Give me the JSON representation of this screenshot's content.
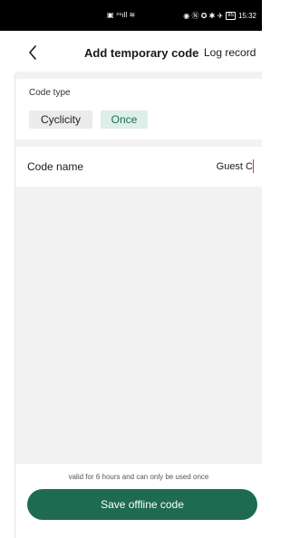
{
  "status_bar": {
    "left_icons": [
      "sim-icon",
      "signal-icon",
      "wifi-icon"
    ],
    "left_text": "▣ ⁴⁶ıll ≋",
    "right_text": "◉ Ⓝ ✪ ✱ ✈",
    "battery": "85",
    "time": "15:32"
  },
  "header": {
    "title": "Add temporary code",
    "log_link": "Log record"
  },
  "code_type": {
    "label": "Code type",
    "options": [
      "Cyclicity",
      "Once"
    ],
    "selected": "Once"
  },
  "code_name": {
    "label": "Code name",
    "value": "Guest C"
  },
  "footer": {
    "hint": "valid for 6 hours and can only be used once",
    "save_label": "Save offline code"
  },
  "colors": {
    "accent": "#1e6b52",
    "chip_selected_bg": "#dcefe8",
    "chip_bg": "#ebebeb",
    "cursor": "#e0312c"
  }
}
